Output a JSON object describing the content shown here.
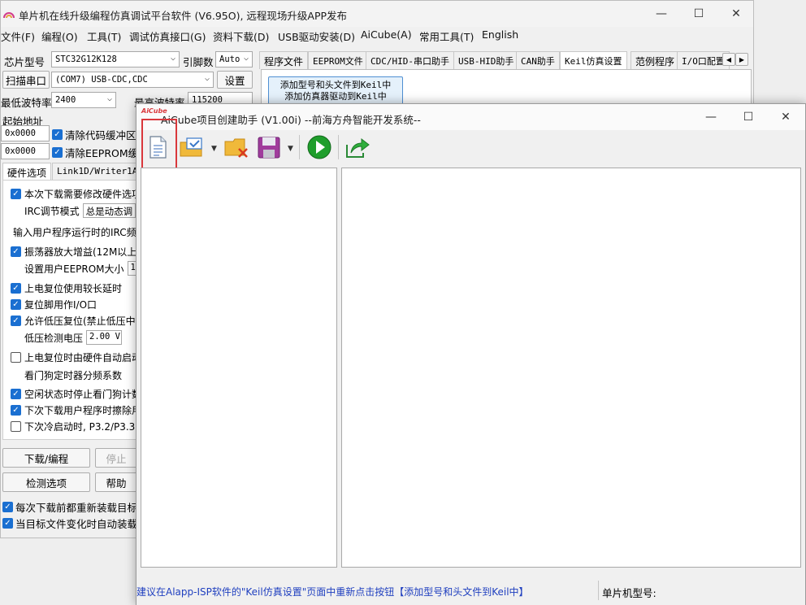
{
  "main_window": {
    "title": "单片机在线升级编程仿真调试平台软件 (V6.95O), 远程现场升级APP发布",
    "menu": [
      "文件(F)",
      "编程(O)",
      "工具(T)",
      "调试仿真接口(G)",
      "资料下载(D)",
      "USB驱动安装(D)",
      "AiCube(A)",
      "常用工具(T)",
      "English"
    ],
    "chip_label": "芯片型号",
    "chip_value": "STC32G12K128",
    "pins_label": "引脚数",
    "pins_value": "Auto",
    "scan_button": "扫描串口",
    "port_value": "(COM7) USB-CDC,CDC",
    "settings_button": "设置",
    "min_baud_label": "最低波特率",
    "min_baud_value": "2400",
    "max_baud_label": "最高波特率",
    "max_baud_value": "115200",
    "start_addr_label": "起始地址",
    "addr1": "0x0000",
    "addr2": "0x0000",
    "clear_code_label": "清除代码缓冲区",
    "clear_eeprom_label": "清除EEPROM缓冲区",
    "hw_tabs": [
      "硬件选项",
      "Link1D/Writer1A/U"
    ],
    "options": [
      {
        "label": "本次下载需要修改硬件选项",
        "checked": true
      },
      {
        "label": "IRC调节模式",
        "value": "总是动态调"
      },
      {
        "label": "输入用户程序运行时的IRC频率"
      },
      {
        "label": "振荡器放大增益(12M以上建议",
        "checked": true
      },
      {
        "label": "设置用户EEPROM大小",
        "value": "1"
      },
      {
        "label": "上电复位使用较长延时",
        "checked": true
      },
      {
        "label": "复位脚用作I/O口",
        "checked": true
      },
      {
        "label": "允许低压复位(禁止低压中断",
        "checked": true
      },
      {
        "label": "低压检测电压",
        "value": "2.00 V"
      },
      {
        "label": "上电复位时由硬件自动启动",
        "checked": false
      },
      {
        "label": "看门狗定时器分频系数"
      },
      {
        "label": "空闲状态时停止看门狗计数",
        "checked": true
      },
      {
        "label": "下次下载用户程序时擦除用",
        "checked": true
      },
      {
        "label": "下次冷启动时, P3.2/P3.3为",
        "checked": false
      }
    ],
    "download_button": "下载/编程",
    "stop_button": "停止",
    "check_button": "检测选项",
    "help_button": "帮助",
    "reload_label": "每次下载前都重新装载目标文",
    "auto_reload_label": "当目标文件变化时自动装载并",
    "right_tabs": [
      "程序文件",
      "EEPROM文件",
      "CDC/HID-串口助手",
      "USB-HID助手",
      "CAN助手",
      "Keil仿真设置",
      "范例程序",
      "I/O口配置"
    ],
    "keil_button_lines": [
      "添加型号和头文件到Keil中",
      "添加仿真器驱动到Keil中"
    ]
  },
  "dialog": {
    "logo_text": "AiCube",
    "title": "AiCube项目创建助手 (V1.00i) --前海方舟智能开发系统--",
    "toolbar_icons": [
      "new-file-icon",
      "open-folder-icon",
      "delete-folder-icon",
      "save-icon",
      "run-icon",
      "export-icon"
    ],
    "status_hint": "建议在Alapp-ISP软件的\"Keil仿真设置\"页面中重新点击按钮【添加型号和头文件到Keil中】",
    "status_model_label": "单片机型号:",
    "colors": {
      "highlight": "#d9373b",
      "hint_text": "#1f3fbf",
      "run_green": "#1f9e2c"
    }
  }
}
